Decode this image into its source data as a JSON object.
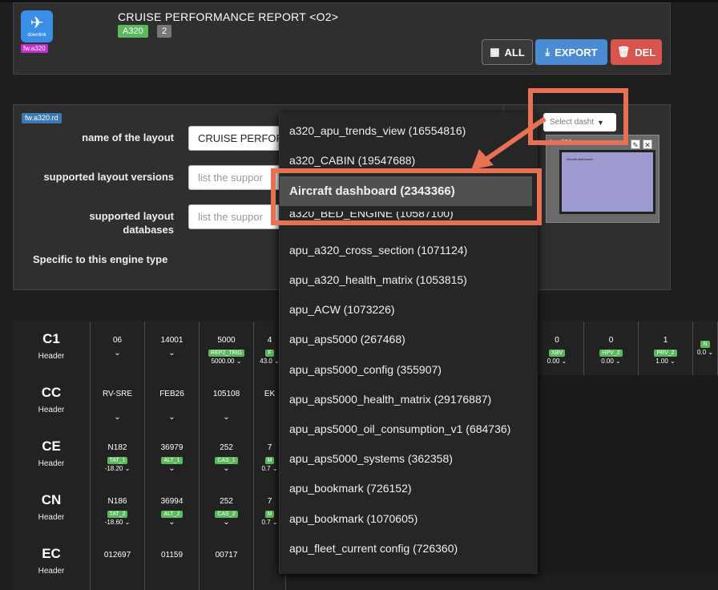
{
  "header": {
    "logo_caption": "downlink",
    "fw_tag": "fw.a320",
    "title": "CRUISE PERFORMANCE REPORT <O2>",
    "badge_aircraft": "A320",
    "badge_count": "2",
    "buttons": {
      "all": "ALL",
      "export": "EXPORT",
      "del": "DEL"
    }
  },
  "form": {
    "rd_tag": "fw.a320.rd",
    "name_label": "name of the layout",
    "name_value": "CRUISE PERFOR",
    "versions_label": "supported layout versions",
    "versions_placeholder": "list the suppor",
    "databases_label_1": "supported layout",
    "databases_label_2": "databases",
    "databases_placeholder": "list the suppor",
    "engine_label": "Specific to this engine type"
  },
  "dashboard_select": {
    "placeholder": "Select dasht"
  },
  "preview": {
    "label": "fw.a320",
    "screen_text": "Aircraft dashboard"
  },
  "dropdown": {
    "items": [
      "a320_apu_trends_view (16554816)",
      "a320_CABIN (19547688)",
      "Aircraft dashboard (2343366)",
      "a320_BED_ENGINE (10587100)",
      "apu_a320_cross_section (1071124)",
      "apu_a320_health_matrix (1053815)",
      "apu_ACW (1073226)",
      "apu_aps5000 (267468)",
      "apu_aps5000_config (355907)",
      "apu_aps5000_health_matrix (29176887)",
      "apu_aps5000_oil_consumption_v1 (684736)",
      "apu_aps5000_systems (362358)",
      "apu_bookmark (726152)",
      "apu_bookmark (1070605)",
      "apu_fleet_current config (726360)"
    ],
    "highlighted_index": 2
  },
  "grid": {
    "header_sub": "Header",
    "rows": [
      {
        "code": "C1",
        "cells": [
          {
            "v": "06",
            "tag": "",
            "val": ""
          },
          {
            "v": "14001",
            "tag": "",
            "val": ""
          },
          {
            "v": "5000",
            "tag": "REP2_TRIG",
            "val": "5000.00"
          },
          {
            "v": "4",
            "tag": "F",
            "val": "43.0"
          }
        ],
        "right": [
          {
            "v": "0",
            "tag": "XBV",
            "val": "0.00"
          },
          {
            "v": "0",
            "tag": "HPV_2",
            "val": "0.00"
          },
          {
            "v": "1",
            "tag": "PRV_2",
            "val": "1.00"
          },
          {
            "v": "",
            "tag": "N",
            "val": "0.0"
          }
        ]
      },
      {
        "code": "CC",
        "cells": [
          {
            "v": "RV-SRE",
            "tag": "",
            "val": ""
          },
          {
            "v": "FEB26",
            "tag": "",
            "val": ""
          },
          {
            "v": "105108",
            "tag": "",
            "val": ""
          },
          {
            "v": "EK",
            "tag": "",
            "val": ""
          }
        ]
      },
      {
        "code": "CE",
        "cells": [
          {
            "v": "N182",
            "tag": "TAT_1",
            "val": "-18.20"
          },
          {
            "v": "36979",
            "tag": "ALT_1",
            "val": ""
          },
          {
            "v": "252",
            "tag": "CAS_1",
            "val": ""
          },
          {
            "v": "7",
            "tag": "M",
            "val": "0.7"
          }
        ]
      },
      {
        "code": "CN",
        "cells": [
          {
            "v": "N186",
            "tag": "TAT_2",
            "val": "-18.60"
          },
          {
            "v": "36994",
            "tag": "ALT_2",
            "val": ""
          },
          {
            "v": "252",
            "tag": "CAS_2",
            "val": ""
          },
          {
            "v": "7",
            "tag": "M",
            "val": "0.7"
          }
        ]
      },
      {
        "code": "EC",
        "cells": [
          {
            "v": "012697",
            "tag": "",
            "val": ""
          },
          {
            "v": "01159",
            "tag": "",
            "val": ""
          },
          {
            "v": "00717",
            "tag": "",
            "val": ""
          },
          {
            "v": "",
            "tag": "",
            "val": ""
          }
        ]
      }
    ]
  },
  "colors": {
    "accent": "#e77055",
    "export": "#4a8bd4",
    "del": "#d9534f",
    "badge_green": "#5cb85c",
    "fw_tag": "#c02fd0"
  }
}
